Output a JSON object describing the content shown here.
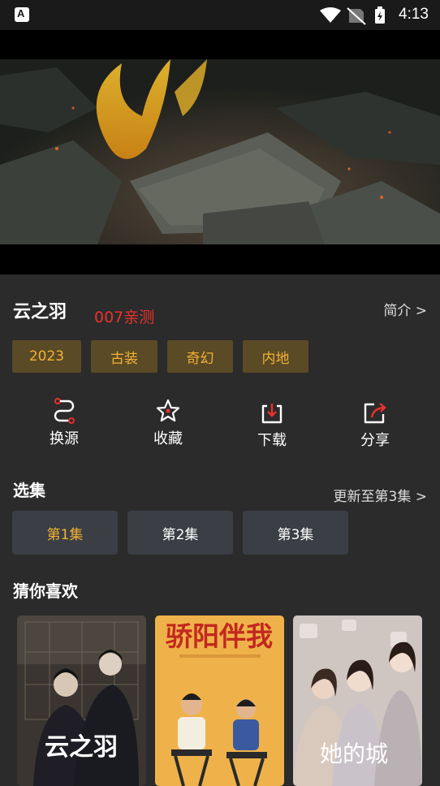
{
  "status_bar": {
    "time": "4:13"
  },
  "show": {
    "title": "云之羽",
    "overlay_text": "007亲测",
    "intro_label": "简介 >",
    "tags": [
      "2023",
      "古装",
      "奇幻",
      "内地"
    ]
  },
  "actions": [
    {
      "label": "换源",
      "icon": "switch-source-icon"
    },
    {
      "label": "收藏",
      "icon": "star-icon"
    },
    {
      "label": "下载",
      "icon": "download-icon"
    },
    {
      "label": "分享",
      "icon": "share-icon"
    }
  ],
  "episodes": {
    "heading": "选集",
    "update_label": "更新至第3集 >",
    "items": [
      "第1集",
      "第2集",
      "第3集"
    ],
    "active_index": 0
  },
  "recommend": {
    "heading": "猜你喜欢",
    "posters": [
      {
        "title": "云之羽"
      },
      {
        "title": "骄阳伴我"
      },
      {
        "title": "她的城"
      }
    ]
  },
  "colors": {
    "accent": "#f2b233",
    "red": "#e8322c",
    "background": "#2b2b2b",
    "chip": "#3b3e45",
    "tag_bg": "#5a4a26"
  }
}
